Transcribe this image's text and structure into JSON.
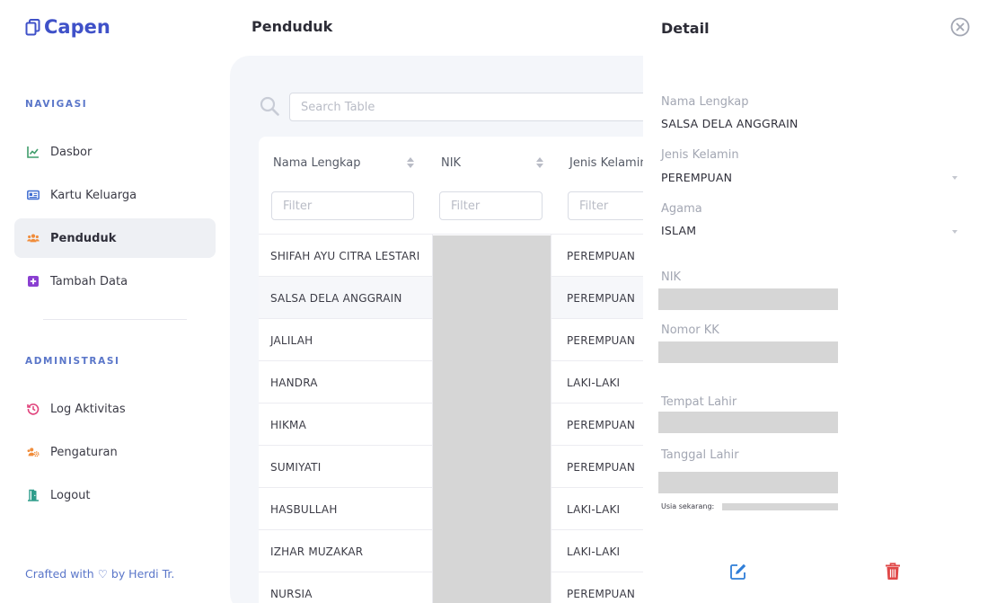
{
  "app": {
    "name": "Capen"
  },
  "sidebar": {
    "section_nav": "NAVIGASI",
    "nav_items": [
      {
        "label": "Dasbor",
        "icon": "chart-line-icon",
        "color": "#3f9d6b"
      },
      {
        "label": "Kartu Keluarga",
        "icon": "id-card-icon",
        "color": "#3f6dd1"
      },
      {
        "label": "Penduduk",
        "icon": "users-icon",
        "color": "#f08c3a",
        "active": true
      },
      {
        "label": "Tambah Data",
        "icon": "plus-square-icon",
        "color": "#8a3fd1"
      }
    ],
    "section_admin": "ADMINISTRASI",
    "admin_items": [
      {
        "label": "Log Aktivitas",
        "icon": "history-icon",
        "color": "#e0407a"
      },
      {
        "label": "Pengaturan",
        "icon": "users-cog-icon",
        "color": "#f08c3a"
      },
      {
        "label": "Logout",
        "icon": "door-open-icon",
        "color": "#2f9d8b"
      }
    ],
    "footer": "Crafted with ♡ by Herdi Tr."
  },
  "main": {
    "title": "Penduduk",
    "search_placeholder": "Search Table",
    "columns": [
      {
        "label": "Nama Lengkap",
        "filter_placeholder": "Filter"
      },
      {
        "label": "NIK",
        "filter_placeholder": "Filter"
      },
      {
        "label": "Jenis Kelamin",
        "filter_placeholder": "Filter"
      }
    ],
    "rows": [
      {
        "nama": "SHIFAH AYU CITRA LESTARI",
        "jk": "PEREMPUAN"
      },
      {
        "nama": "SALSA DELA ANGGRAIN",
        "jk": "PEREMPUAN",
        "selected": true
      },
      {
        "nama": "JALILAH",
        "jk": "PEREMPUAN"
      },
      {
        "nama": "HANDRA",
        "jk": "LAKI-LAKI"
      },
      {
        "nama": "HIKMA",
        "jk": "PEREMPUAN"
      },
      {
        "nama": "SUMIYATI",
        "jk": "PEREMPUAN"
      },
      {
        "nama": "HASBULLAH",
        "jk": "LAKI-LAKI"
      },
      {
        "nama": "IZHAR MUZAKAR",
        "jk": "LAKI-LAKI"
      },
      {
        "nama": "NURSIA",
        "jk": "PEREMPUAN"
      }
    ]
  },
  "detail": {
    "title": "Detail",
    "nama_label": "Nama Lengkap",
    "nama_value": "SALSA DELA ANGGRAIN",
    "jk_label": "Jenis Kelamin",
    "jk_value": "PEREMPUAN",
    "agama_label": "Agama",
    "agama_value": "ISLAM",
    "nik_label": "NIK",
    "kk_label": "Nomor KK",
    "tempat_label": "Tempat Lahir",
    "tanggal_label": "Tanggal Lahir",
    "usia_label": "Usia sekarang:"
  },
  "colors": {
    "brand": "#3f51c8",
    "accent_blue": "#5a76c9",
    "edit": "#2f7ed8",
    "delete": "#e04848",
    "redaction": "#d6d6d6"
  }
}
